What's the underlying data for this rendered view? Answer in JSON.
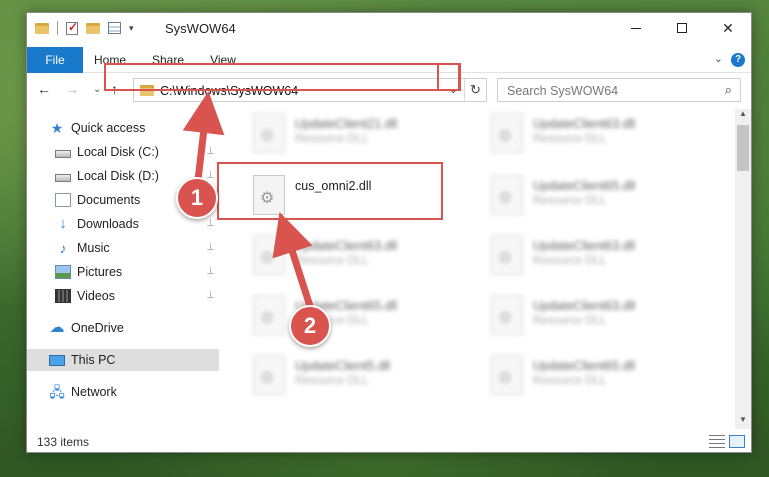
{
  "window": {
    "title": "SysWOW64",
    "minimize_glyph": "",
    "close_glyph": "✕"
  },
  "ribbon": {
    "tabs": [
      "File",
      "Home",
      "Share",
      "View"
    ],
    "help": "?",
    "chevron": "⌄"
  },
  "nav": {
    "back": "←",
    "forward": "→",
    "recent": "⌄",
    "up": "↑",
    "address": "C:\\Windows\\SysWOW64",
    "address_dropdown": "⌄",
    "refresh": "↻",
    "search_placeholder": "Search SysWOW64",
    "search_icon": "⌕"
  },
  "sidebar": {
    "items": [
      {
        "label": "Quick access",
        "icon": "star-icon",
        "pinned": false
      },
      {
        "label": "Local Disk (C:)",
        "icon": "drive-icon",
        "pinned": true
      },
      {
        "label": "Local Disk (D:)",
        "icon": "drive-icon",
        "pinned": true
      },
      {
        "label": "Documents",
        "icon": "documents-icon",
        "pinned": true
      },
      {
        "label": "Downloads",
        "icon": "download-icon",
        "pinned": true
      },
      {
        "label": "Music",
        "icon": "music-icon",
        "pinned": true
      },
      {
        "label": "Pictures",
        "icon": "pictures-icon",
        "pinned": true
      },
      {
        "label": "Videos",
        "icon": "videos-icon",
        "pinned": true
      },
      {
        "label": "OneDrive",
        "icon": "cloud-icon",
        "pinned": false
      },
      {
        "label": "This PC",
        "icon": "computer-icon",
        "pinned": false,
        "selected": true
      },
      {
        "label": "Network",
        "icon": "network-icon",
        "pinned": false
      }
    ],
    "pin_glyph": "📌"
  },
  "files": [
    {
      "name": "UpdateClient21.dll",
      "type": "Resource DLL",
      "blurred": true
    },
    {
      "name": "UpdateClient63.dll",
      "type": "Resource DLL",
      "blurred": true
    },
    {
      "name": "cus_omni2.dll",
      "type": "",
      "blurred": false,
      "highlighted": true
    },
    {
      "name": "UpdateClient65.dll",
      "type": "Resource DLL",
      "blurred": true
    },
    {
      "name": "UpdateClient63.dll",
      "type": "Resource DLL",
      "blurred": true
    },
    {
      "name": "UpdateClient63.dll",
      "type": "Resource DLL",
      "blurred": true
    },
    {
      "name": "UpdateClient65.dll",
      "type": "Resource DLL",
      "blurred": true
    },
    {
      "name": "UpdateClient63.dll",
      "type": "Resource DLL",
      "blurred": true
    },
    {
      "name": "UpdateClient5.dll",
      "type": "Resource DLL",
      "blurred": true
    },
    {
      "name": "UpdateClient65.dll",
      "type": "Resource DLL",
      "blurred": true
    }
  ],
  "status": {
    "item_count": "133 items"
  },
  "callouts": {
    "one": "1",
    "two": "2",
    "color": "#d9534f"
  },
  "colors": {
    "accent": "#1979ca",
    "highlight": "#d9534f"
  }
}
